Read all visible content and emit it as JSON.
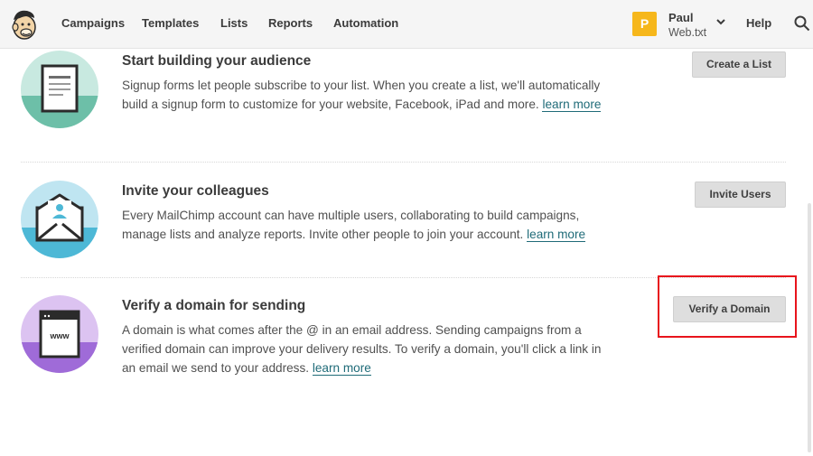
{
  "nav": {
    "items": [
      "Campaigns",
      "Templates",
      "Lists",
      "Reports",
      "Automation"
    ],
    "user": {
      "initial": "P",
      "name": "Paul",
      "account": "Web.txt"
    },
    "help": "Help",
    "icons": {
      "logo": "mailchimp-logo",
      "chevron": "chevron-down-icon",
      "search": "search-icon"
    }
  },
  "rows": [
    {
      "title": "Start building your audience",
      "desc": "Signup forms let people subscribe to your list. When you create a list, we'll automatically build a signup form to customize for your website, Facebook, iPad and more.",
      "link": "learn more",
      "button": "Create a List",
      "illustration": "signup-form-icon",
      "color": "#6dbfa8"
    },
    {
      "title": "Invite your colleagues",
      "desc": "Every MailChimp account can have multiple users, collaborating to build campaigns, manage lists and analyze reports. Invite other people to join your account.",
      "link": "learn more",
      "button": "Invite Users",
      "illustration": "envelope-user-icon",
      "color": "#4db8d6"
    },
    {
      "title": "Verify a domain for sending",
      "desc": "A domain is what comes after the @ in an email address. Sending campaigns from a verified domain can improve your delivery results. To verify a domain, you'll click a link in an email we send to your address.",
      "link": "learn more",
      "button": "Verify a Domain",
      "illustration": "www-browser-icon",
      "color": "#9f6bd8"
    }
  ],
  "colors": {
    "highlight": "#e8141c",
    "avatar": "#f6b71b",
    "link": "#1f6b78"
  }
}
